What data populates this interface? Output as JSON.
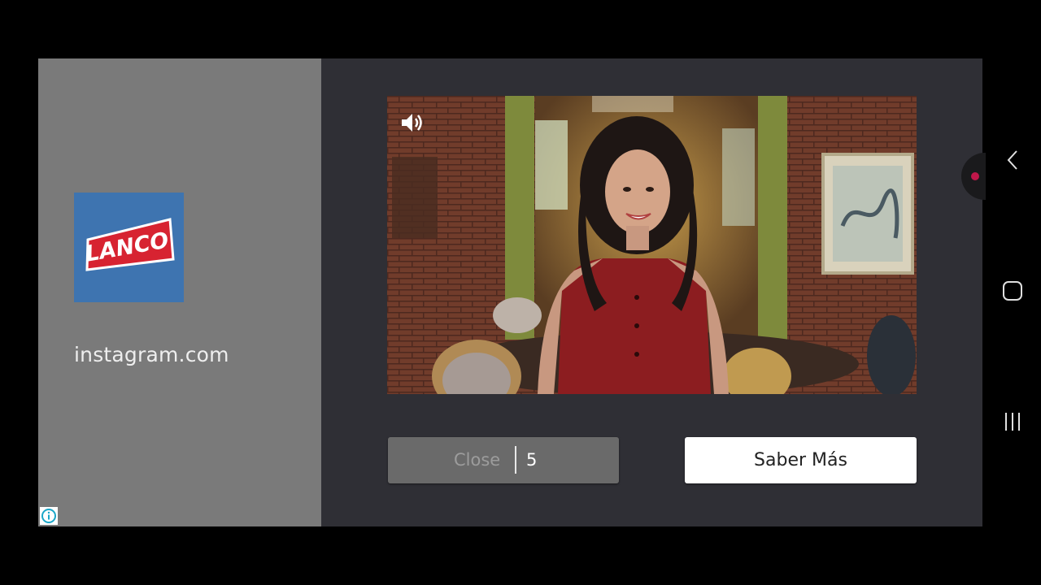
{
  "advertiser": {
    "logo_text": "LANCO",
    "domain": "instagram.com"
  },
  "video": {
    "volume_icon": "volume-icon"
  },
  "actions": {
    "close_label": "Close",
    "close_countdown": "5",
    "cta_label": "Saber Más"
  },
  "system_nav": {
    "back_icon": "chevron-left-icon",
    "home_icon": "rounded-square-icon",
    "recents_icon": "three-bars-icon"
  },
  "colors": {
    "logo_background": "#3e74b0",
    "logo_red": "#d72331",
    "left_panel": "#7a7a7a",
    "right_panel": "#2f2f35",
    "close_button": "#6a6a6a",
    "cta_button": "#ffffff",
    "edge_dot": "#c0174a"
  }
}
